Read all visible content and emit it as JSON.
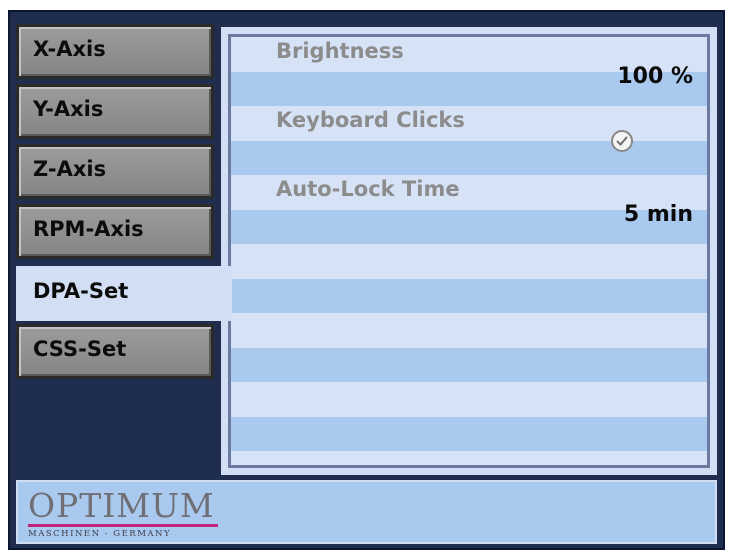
{
  "tabs": [
    {
      "label": "X-Axis",
      "active": false
    },
    {
      "label": "Y-Axis",
      "active": false
    },
    {
      "label": "Z-Axis",
      "active": false
    },
    {
      "label": "RPM-Axis",
      "active": false
    },
    {
      "label": "DPA-Set",
      "active": true
    },
    {
      "label": "CSS-Set",
      "active": false
    }
  ],
  "settings": {
    "brightness_label": "Brightness",
    "brightness_value": "100  %",
    "keyboard_clicks_label": "Keyboard Clicks",
    "keyboard_clicks_checked": true,
    "auto_lock_label": "Auto-Lock Time",
    "auto_lock_value": "5 min"
  },
  "footer": {
    "logo_text": "OPTIMUM",
    "logo_subtitle": "MASCHINEN  -  GERMANY"
  },
  "colors": {
    "frame": "#1f2d4e",
    "panel_light": "#d6e3f7",
    "panel_stripe": "#a9c9ef",
    "tab_gray": "#8f8f8f",
    "logo_accent": "#c2267a"
  },
  "icons": {
    "checkbox": "check-circle-icon"
  }
}
